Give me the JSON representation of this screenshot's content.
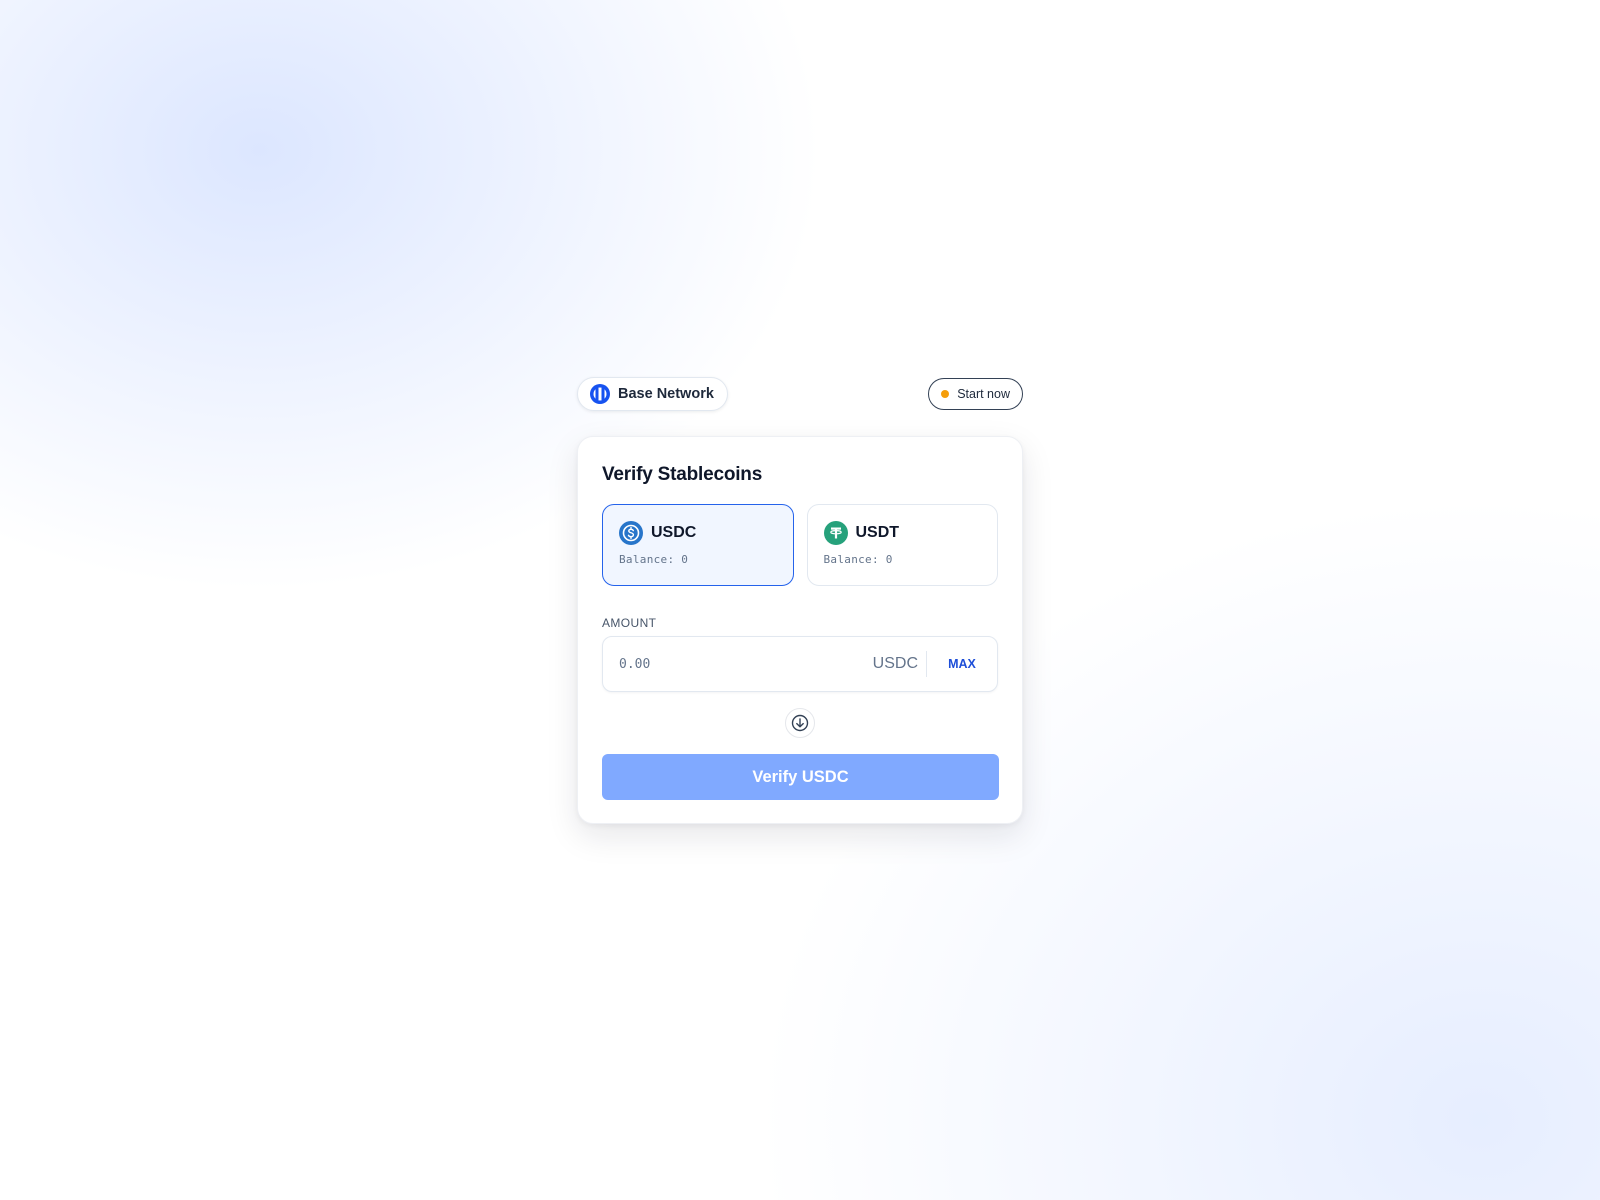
{
  "header": {
    "network_label": "Base Network",
    "network_icon": "base-logo-icon",
    "start_label": "Start now",
    "status_color": "#f59e0b"
  },
  "card": {
    "title": "Verify Stablecoins",
    "tokens": [
      {
        "symbol": "USDC",
        "balance": "Balance: 0",
        "icon": "usdc-icon",
        "color": "#2775ca",
        "selected": true
      },
      {
        "symbol": "USDT",
        "balance": "Balance: 0",
        "icon": "usdt-icon",
        "color": "#26a17b",
        "selected": false
      }
    ],
    "amount": {
      "label": "AMOUNT",
      "value": "",
      "placeholder": "0.00",
      "unit": "USDC",
      "max_label": "MAX"
    },
    "swap_icon": "arrow-down-circle-icon",
    "submit_label": "Verify USDC"
  },
  "colors": {
    "accent": "#2563eb",
    "button_disabled": "#80a9ff"
  }
}
